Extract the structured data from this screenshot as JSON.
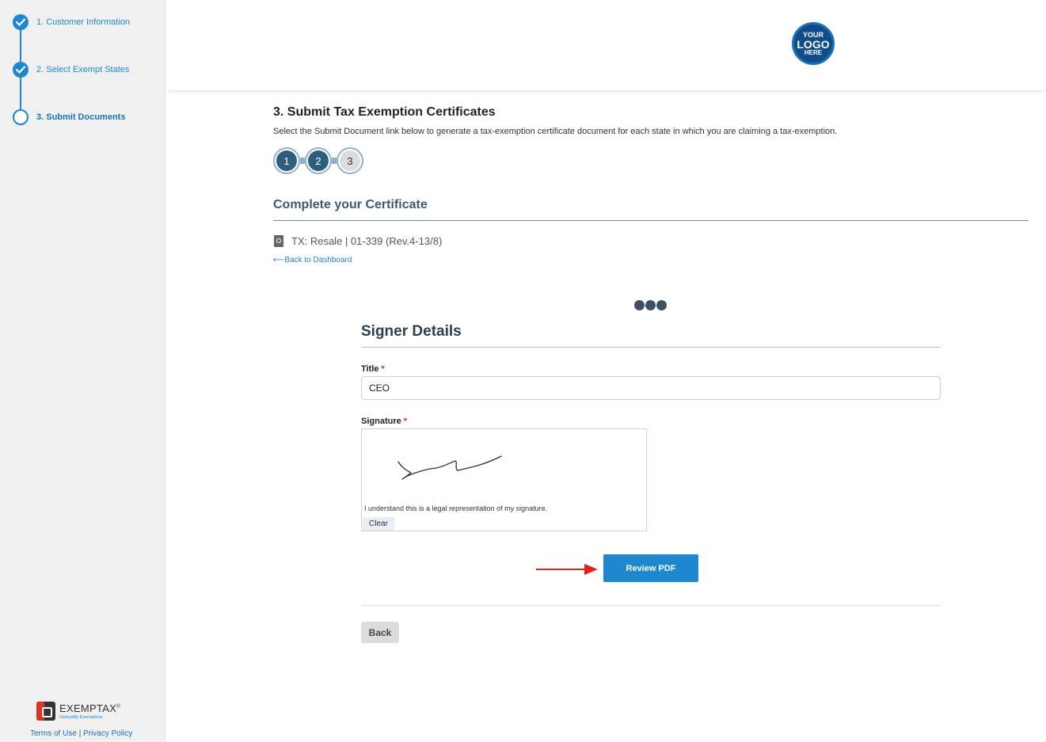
{
  "sidebar": {
    "steps": [
      {
        "label": "1. Customer Information",
        "state": "done"
      },
      {
        "label": "2. Select Exempt States",
        "state": "done"
      },
      {
        "label": "3. Submit Documents",
        "state": "current"
      }
    ],
    "brand": {
      "name": "EXEMPTAX",
      "tagline": "Demystify Exemptions"
    },
    "footer": {
      "terms": "Terms of Use",
      "separator": "|",
      "privacy": "Privacy Policy"
    }
  },
  "header": {
    "logo": {
      "line1": "YOUR",
      "line2": "LOGO",
      "line3": "HERE"
    }
  },
  "main": {
    "title": "3. Submit Tax Exemption Certificates",
    "description": "Select the Submit Document link below to generate a tax-exemption certificate document for each state in which you are claiming a tax-exemption.",
    "progress": [
      {
        "number": "1",
        "state": "done"
      },
      {
        "number": "2",
        "state": "done"
      },
      {
        "number": "3",
        "state": "current"
      }
    ],
    "section_title": "Complete your Certificate",
    "certificate": "TX: Resale | 01-339 (Rev.4-13/8)",
    "back_to_dashboard": "Back to Dashboard",
    "back_arrow": "⟵"
  },
  "form": {
    "heading": "Signer Details",
    "title_label": "Title",
    "required_mark": "*",
    "title_value": "CEO",
    "signature_label": "Signature",
    "signature_note": "I understand this is a legal representation of my signature.",
    "clear_label": "Clear",
    "review_label": "Review PDF",
    "back_label": "Back"
  },
  "colors": {
    "accent": "#1d87d0",
    "sidebar_bg": "#f0f0f0",
    "step_done": "#2e5d7e",
    "required": "#d9262b",
    "annotation_arrow": "#e0201b"
  }
}
